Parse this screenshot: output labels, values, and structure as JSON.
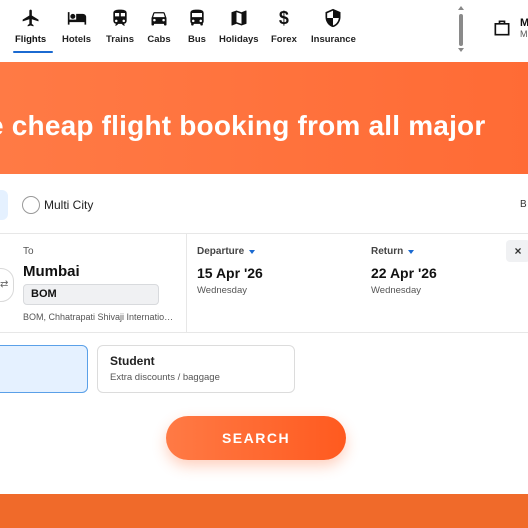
{
  "nav": {
    "items": [
      {
        "label": "Flights",
        "icon": "airplane-icon"
      },
      {
        "label": "Hotels",
        "icon": "bed-icon"
      },
      {
        "label": "Trains",
        "icon": "train-icon"
      },
      {
        "label": "Cabs",
        "icon": "car-icon"
      },
      {
        "label": "Bus",
        "icon": "bus-icon"
      },
      {
        "label": "Holidays",
        "icon": "map-icon"
      },
      {
        "label": "Forex",
        "icon": "dollar-icon"
      },
      {
        "label": "Insurance",
        "icon": "shield-icon"
      }
    ],
    "active": "Flights",
    "trips_line1": "M",
    "trips_line2": "M"
  },
  "banner": {
    "text": "e cheap flight booking from all major"
  },
  "trip_types": {
    "multi_city": "Multi City",
    "right_cut": "B"
  },
  "to": {
    "label": "To",
    "city": "Mumbai",
    "code": "BOM",
    "airport": "BOM, Chhatrapati Shivaji International Airport"
  },
  "departure": {
    "label": "Departure",
    "date": "15 Apr '26",
    "day": "Wednesday"
  },
  "return": {
    "label": "Return",
    "date": "22 Apr '26",
    "day": "Wednesday"
  },
  "close_label": "×",
  "swap_label": "⇄",
  "fares": {
    "student_title": "Student",
    "student_sub": "Extra discounts / baggage"
  },
  "search_label": "SEARCH",
  "colors": {
    "accent": "#ff6b35",
    "selected_bg": "#e5f1ff",
    "selected_border": "#5aa0e8",
    "link_blue": "#1b6ad1"
  }
}
